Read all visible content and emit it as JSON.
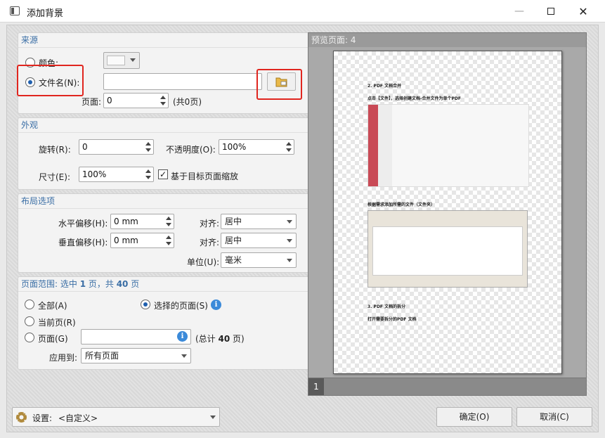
{
  "window": {
    "title": "添加背景"
  },
  "source": {
    "header": "来源",
    "color_label": "颜色:",
    "filename_label": "文件名(N):",
    "filename_value": "",
    "page_label": "页面:",
    "page_value": "0",
    "page_count": "(共0页)"
  },
  "appearance": {
    "header": "外观",
    "rotation_label": "旋转(R):",
    "rotation_value": "0",
    "opacity_label": "不透明度(O):",
    "opacity_value": "100%",
    "size_label": "尺寸(E):",
    "size_value": "100%",
    "scale_label": "基于目标页面缩放"
  },
  "layout": {
    "header": "布局选项",
    "h_offset_label": "水平偏移(H):",
    "h_offset_value": "0 mm",
    "v_offset_label": "垂直偏移(H):",
    "v_offset_value": "0 mm",
    "align_label_1": "对齐:",
    "align_value_1": "居中",
    "align_label_2": "对齐:",
    "align_value_2": "居中",
    "unit_label": "单位(U):",
    "unit_value": "毫米"
  },
  "page_range": {
    "header_prefix": "页面范围: 选中 ",
    "selected_count": "1",
    "header_mid": " 页，共 ",
    "total_count": "40",
    "header_suffix": " 页",
    "all_label": "全部(A)",
    "selected_pages_label": "选择的页面(S)",
    "current_label": "当前页(R)",
    "pages_label": "页面(G)",
    "pages_value": "",
    "total_prefix": "(总计 ",
    "total_suffix": " 页)",
    "apply_label": "应用到:",
    "apply_value": "所有页面"
  },
  "preview": {
    "title": "预览页面: 4",
    "page_number": "1",
    "doc_heading_1": "2. PDF 文档合并",
    "doc_line_1": "点击【文件】，选择创建文档-合并文件为单个PDF",
    "doc_line_2": "根据需求添加所需的文件（文件夹）",
    "doc_heading_2": "3. PDF 文档的拆分",
    "doc_line_3": "打开需要拆分的PDF 文档"
  },
  "footer": {
    "settings_label": "设置:",
    "settings_value": "<自定义>",
    "ok_label": "确定(O)",
    "cancel_label": "取消(C)"
  }
}
